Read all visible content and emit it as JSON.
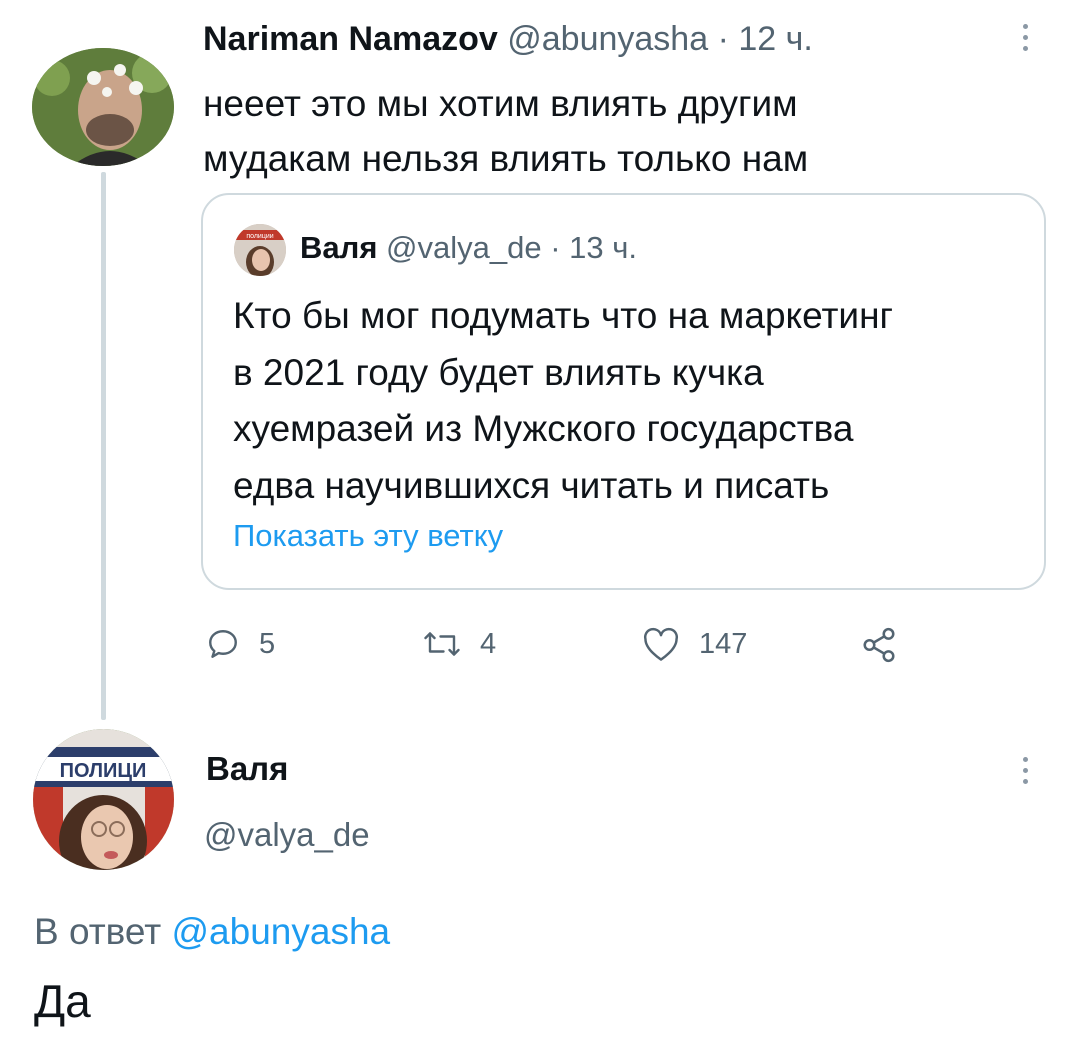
{
  "tweet1": {
    "author_name": "Nariman Namazov",
    "handle": "@abunyasha",
    "time": "· 12 ч.",
    "text_line1": "нееет это мы хотим влиять другим",
    "text_line2": "мудакам нельзя влиять только нам",
    "quote": {
      "author_name": "Валя",
      "handle": "@valya_de",
      "time": "· 13 ч.",
      "lines": [
        "Кто бы мог подумать что на маркетинг",
        "в 2021 году будет влиять кучка",
        "хуемразей из Мужского государства",
        "едва научившихся читать и писать"
      ],
      "show_thread": "Показать эту ветку",
      "avatar_sign": "полиции"
    },
    "actions": {
      "replies": "5",
      "retweets": "4",
      "likes": "147"
    }
  },
  "tweet2": {
    "author_name": "Валя",
    "handle": "@valya_de",
    "avatar_sign": "ПОЛИЦИ",
    "reply_prefix": "В ответ",
    "reply_handle": "@abunyasha",
    "text": "Да"
  },
  "colors": {
    "link": "#1d9bf0",
    "muted": "#536471",
    "border": "#cfd9de"
  },
  "icons": [
    "reply-icon",
    "retweet-icon",
    "like-icon",
    "share-icon",
    "more-icon"
  ]
}
